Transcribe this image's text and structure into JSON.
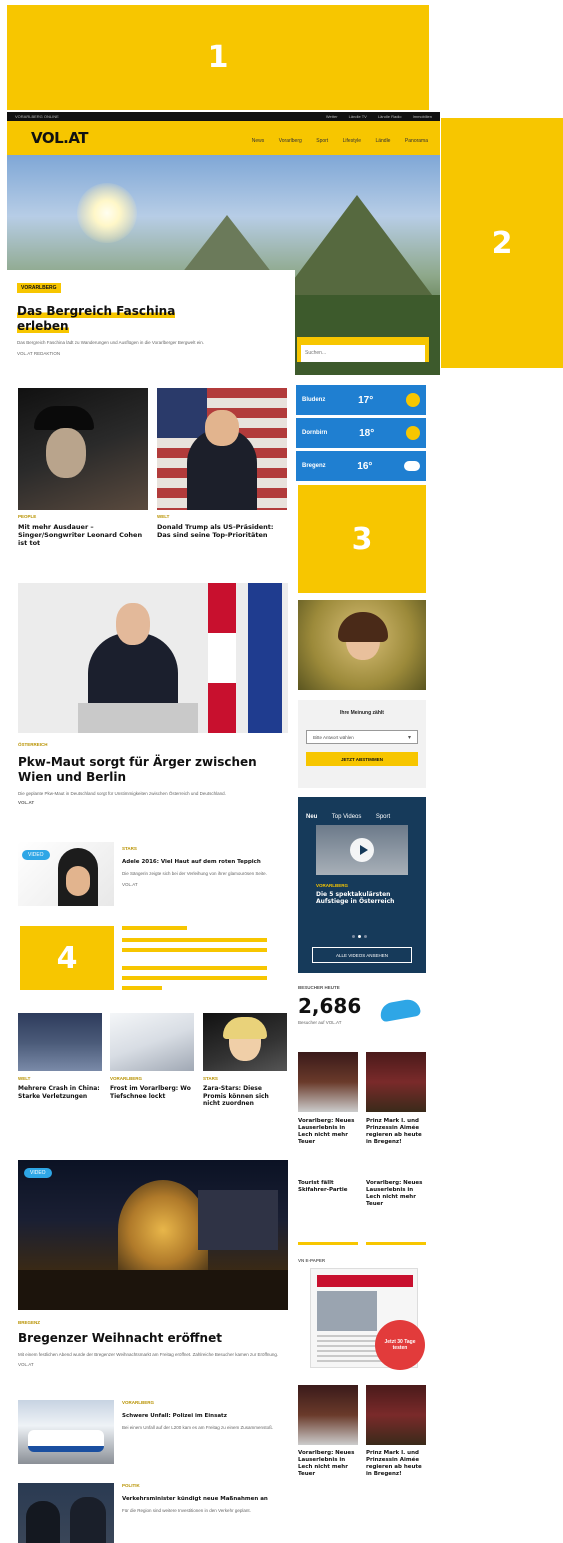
{
  "ad_slots": {
    "slot1": "1",
    "slot2": "2",
    "slot3": "3",
    "slot4": "4"
  },
  "topbar": {
    "left": "VORARLBERG ONLINE",
    "links": [
      "Wetter",
      "Ländle TV",
      "Ländle Radio",
      "Immobilien"
    ]
  },
  "header": {
    "logo": "VOL.AT",
    "nav": [
      "News",
      "Vorarlberg",
      "Sport",
      "Lifestyle",
      "Ländle",
      "Panorama"
    ]
  },
  "hero": {
    "badge": "VORARLBERG",
    "title_line1": "Das Bergreich Faschina",
    "title_line2": "erleben",
    "summary": "Das Bergreich Faschina lädt zu Wanderungen und Ausflügen in die Vorarlberger Bergwelt ein.",
    "byline": "VOL.AT REDAKTION",
    "search_placeholder": "Suchen..."
  },
  "weather": [
    {
      "city": "Bludenz",
      "temp": "17°",
      "icon": "sun-icon"
    },
    {
      "city": "Dornbirn",
      "temp": "18°",
      "icon": "sun-icon"
    },
    {
      "city": "Bregenz",
      "temp": "16°",
      "icon": "cloud-icon"
    }
  ],
  "news_pair": [
    {
      "cat": "PEOPLE",
      "title": "Mit mehr Ausdauer – Singer/Songwriter Leonard Cohen ist tot"
    },
    {
      "cat": "WELT",
      "title": "Donald Trump als US-Präsident: Das sind seine Top-Prioritäten"
    }
  ],
  "lead2": {
    "cat": "ÖSTERREICH",
    "title_line1": "Pkw-Maut sorgt für Ärger zwischen",
    "title_line2": "Wien und Berlin",
    "summary": "Die geplante Pkw-Maut in Deutschland sorgt für Unstimmigkeiten zwischen Österreich und Deutschland.",
    "byline": "VOL.AT"
  },
  "teaser_small": {
    "pill": "VIDEO",
    "cat": "STARS",
    "title": "Adele 2016: Viel Haut auf dem roten Teppich",
    "summary": "Die Sängerin zeigte sich bei der Verleihung von ihrer glamourösen Seite.",
    "byline": "VOL.AT"
  },
  "three_news": [
    {
      "cat": "WELT",
      "title": "Mehrere Crash in China: Starke Verletzungen"
    },
    {
      "cat": "VORARLBERG",
      "title": "Frost im Vorarlberg: Wo Tiefschnee lockt"
    },
    {
      "cat": "STARS",
      "title": "Zara-Stars: Diese Promis können sich nicht zuordnen"
    }
  ],
  "poll": {
    "question": "Ihre Meinung zählt",
    "select_value": "Bitte Antwort wählen",
    "button": "JETZT ABSTIMMEN"
  },
  "video": {
    "tabs": [
      "Neu",
      "Top Videos",
      "Sport"
    ],
    "cat": "VORARLBERG",
    "title": "Die 5 spektakulärsten Aufstiege in Österreich",
    "button": "ALLE VIDEOS ANSEHEN"
  },
  "counter": {
    "label": "BESUCHER HEUTE",
    "value": "2,686",
    "sub": "Besucher auf VOL.AT"
  },
  "right_grid": [
    {
      "title": "Vorarlberg: Neues Lauserlebnis in Lech nicht mehr Teuer"
    },
    {
      "title": "Prinz Mark I. und Prinzessin Aimée regieren ab heute in Bregenz!"
    },
    {
      "title": "Tourist fällt Skifahrer-Partie"
    },
    {
      "title": "Vorarlberg: Neues Lauserlebnis in Lech nicht mehr Teuer"
    }
  ],
  "lead3": {
    "pill": "VIDEO",
    "cat": "BREGENZ",
    "title": "Bregenzer Weihnacht eröffnet",
    "summary": "Mit einem festlichen Abend wurde der Bregenzer Weihnachtsmarkt am Freitag eröffnet. Zahlreiche Besucher kamen zur Eröffnung.",
    "byline": "VOL.AT"
  },
  "bottom_list": [
    {
      "cat": "VORARLBERG",
      "title": "Schwere Unfall: Polizei im Einsatz",
      "summary": "Bei einem Unfall auf der L200 kam es am Freitag zu einem Zusammenstoß."
    },
    {
      "cat": "POLITIK",
      "title": "Verkehrsminister kündigt neue Maßnahmen an",
      "summary": "Für die Region sind weitere Investitionen in den Verkehr geplant."
    }
  ],
  "newspaper": {
    "label": "VN E-PAPER",
    "badge": "Jetzt 30 Tage testen"
  },
  "right_grid2": [
    {
      "title": "Vorarlberg: Neues Lauserlebnis in Lech nicht mehr Teuer"
    },
    {
      "title": "Prinz Mark I. und Prinzessin Aimée regieren ab heute in Bregenz!"
    }
  ],
  "colors": {
    "brand": "#f7c600",
    "weather": "#1f7fd1",
    "video_bg": "#163a5a",
    "accent_blue": "#2ea6e6"
  }
}
